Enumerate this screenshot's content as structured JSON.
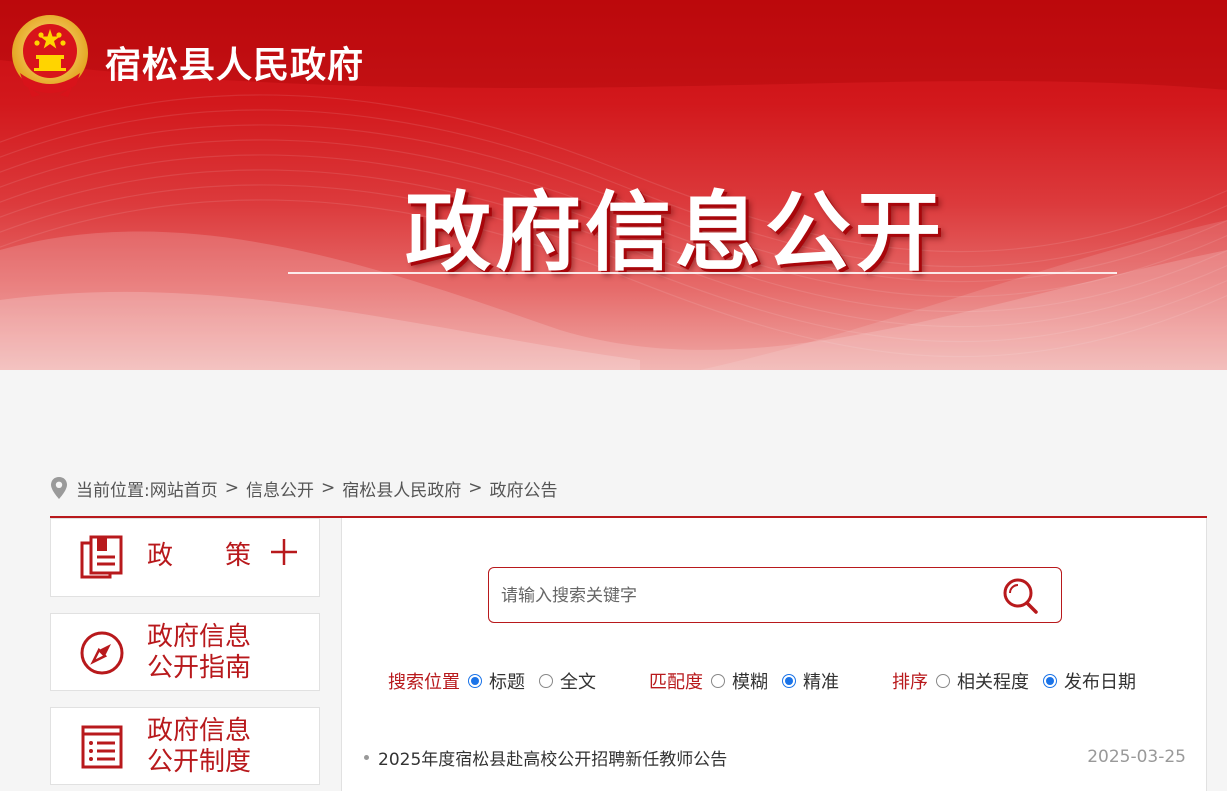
{
  "header": {
    "site_name": "宿松县人民政府",
    "banner_title": "政府信息公开",
    "emblem": "national-emblem-icon"
  },
  "breadcrumb": {
    "prefix": "当前位置:",
    "items": [
      "网站首页",
      "信息公开",
      "宿松县人民政府",
      "政府公告"
    ],
    "separator": ">"
  },
  "sidebar": {
    "items": [
      {
        "label": "政　　策",
        "icon": "policy-document-icon",
        "expand": "plus-icon"
      },
      {
        "label_lines": [
          "政府信息",
          "公开指南"
        ],
        "icon": "compass-icon"
      },
      {
        "label_lines": [
          "政府信息",
          "公开制度"
        ],
        "icon": "list-document-icon"
      }
    ]
  },
  "search": {
    "placeholder": "请输入搜索关键字",
    "icon": "search-icon"
  },
  "filters": {
    "position": {
      "label": "搜索位置",
      "options": [
        "标题",
        "全文"
      ],
      "selected": "标题"
    },
    "match": {
      "label": "匹配度",
      "options": [
        "模糊",
        "精准"
      ],
      "selected": "精准"
    },
    "sort": {
      "label": "排序",
      "options": [
        "相关程度",
        "发布日期"
      ],
      "selected": "发布日期"
    }
  },
  "results": [
    {
      "title": "2025年度宿松县赴高校公开招聘新任教师公告",
      "date": "2025-03-25"
    }
  ],
  "colors": {
    "brand_red": "#b8191c",
    "banner_red": "#c80b10",
    "radio_blue": "#1a73e8"
  }
}
